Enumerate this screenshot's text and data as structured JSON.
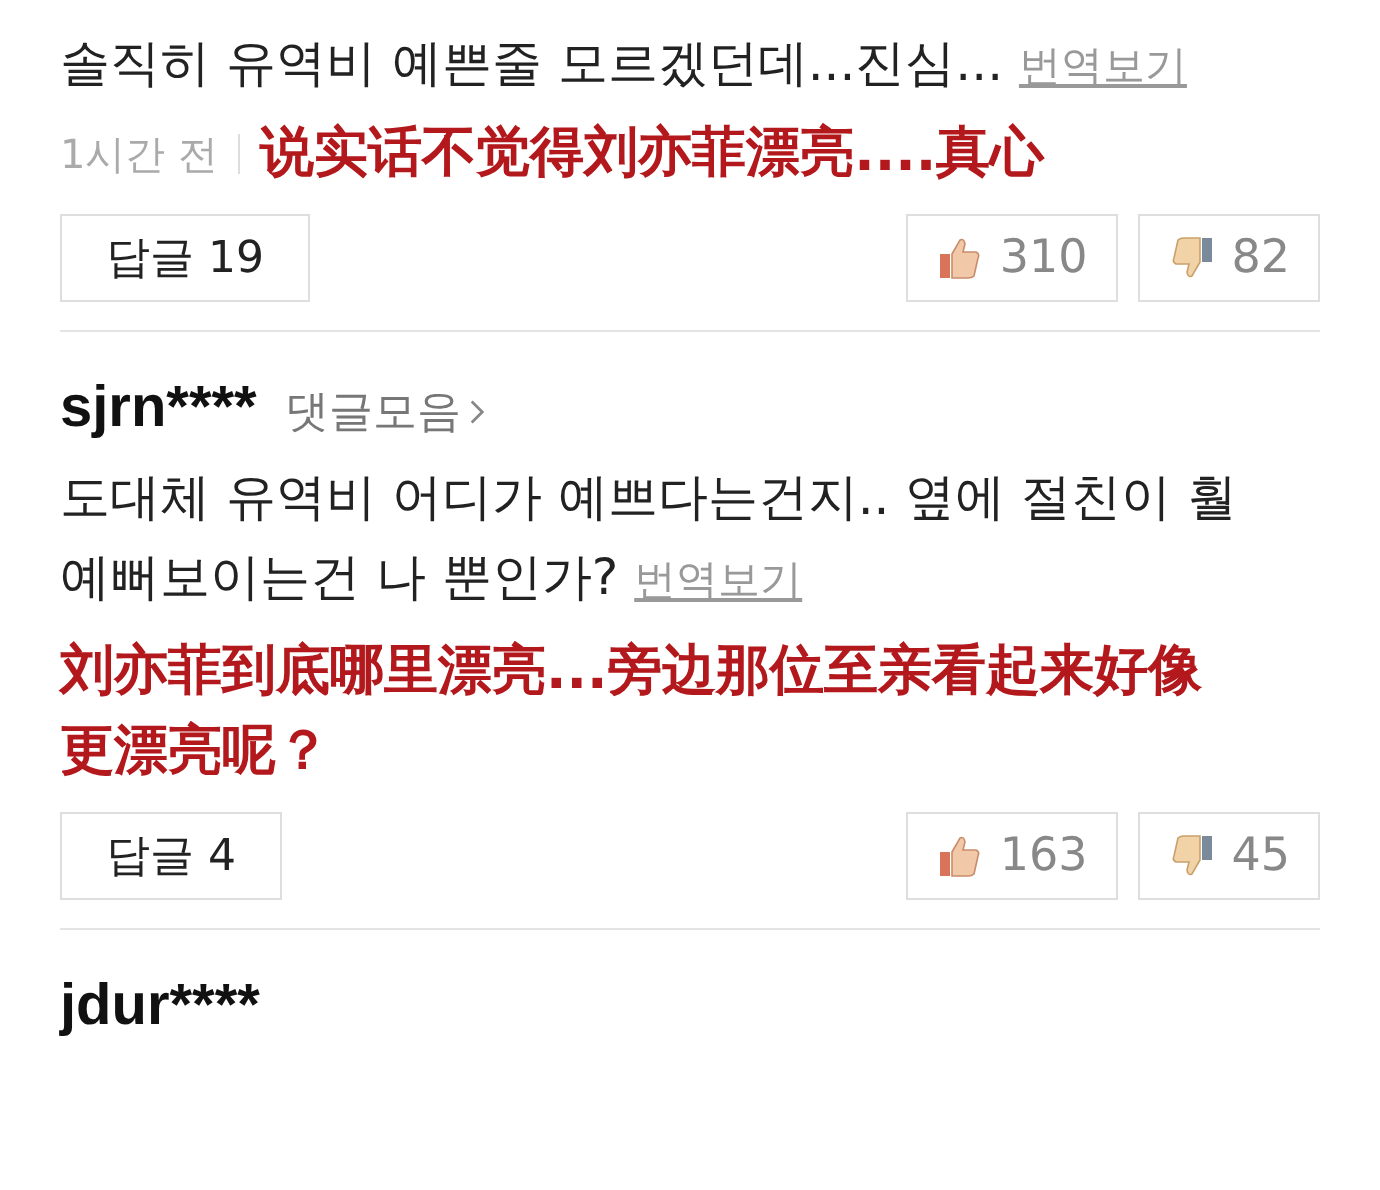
{
  "comments": [
    {
      "text": "솔직히 유역비 예쁜줄 모르겠던데...진심...",
      "translate_link": "번역보기",
      "time": "1시간 전",
      "translation": "说实话不觉得刘亦菲漂亮....真心",
      "reply_button": "답글 19",
      "likes": "310",
      "dislikes": "82"
    },
    {
      "username": "sjrn****",
      "more_link": "댓글모음",
      "text": "도대체 유역비 어디가 예쁘다는건지.. 옆에 절친이 훨 예뻐보이는건 나 뿐인가?",
      "translate_link": "번역보기",
      "translation": "刘亦菲到底哪里漂亮...旁边那位至亲看起来好像更漂亮呢？",
      "reply_button": "답글 4",
      "likes": "163",
      "dislikes": "45"
    },
    {
      "username": "jdur****"
    }
  ]
}
